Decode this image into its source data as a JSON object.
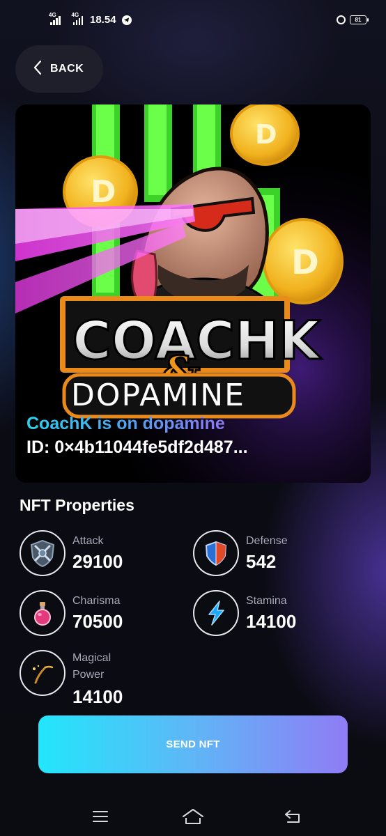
{
  "status_bar": {
    "network_1": "4G",
    "network_2": "4G",
    "time": "18.54",
    "battery": "81"
  },
  "back_button": {
    "label": "BACK"
  },
  "nft": {
    "artwork_title_line1": "COACHK",
    "artwork_title_ampersand": "&",
    "artwork_title_line2": "DOPAMINE",
    "name": "CoachK is on dopamine",
    "id": "ID: 0×4b11044fe5df2d487..."
  },
  "properties": {
    "title": "NFT Properties",
    "items": [
      {
        "name": "Attack",
        "value": "29100",
        "icon": "shield-swords-icon"
      },
      {
        "name": "Defense",
        "value": "542",
        "icon": "shield-icon"
      },
      {
        "name": "Charisma",
        "value": "70500",
        "icon": "potion-icon"
      },
      {
        "name": "Stamina",
        "value": "14100",
        "icon": "lightning-icon"
      },
      {
        "name": "Magical Power",
        "value": "14100",
        "icon": "magic-wand-icon"
      }
    ]
  },
  "send_button": {
    "label": "SEND NFT"
  },
  "colors": {
    "accent_start": "#22e6fb",
    "accent_end": "#8f7cf5",
    "background": "#0b0b12"
  }
}
